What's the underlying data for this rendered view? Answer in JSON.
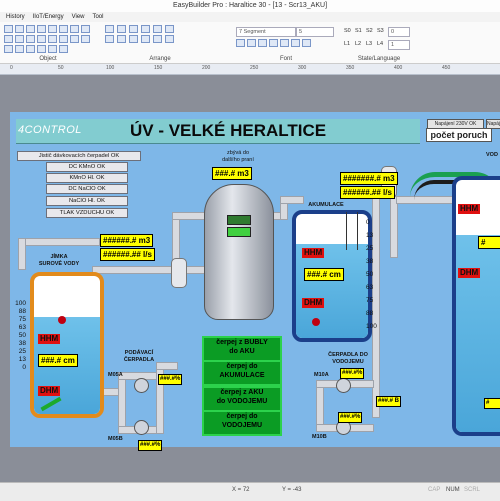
{
  "window": {
    "title": "EasyBuilder Pro : Haraltice 30 - [13 - Scr13_AKU]"
  },
  "menu": [
    "History",
    "IIoT/Energy",
    "View",
    "Tool"
  ],
  "ribbon": {
    "groups": {
      "object": "Object",
      "arrange": "Arrange",
      "font": "Font",
      "state": "State/Language"
    },
    "font_name": "7 Segment",
    "font_size": "5",
    "state_buttons": [
      "S0",
      "S1",
      "S2",
      "S3"
    ],
    "lang_buttons": [
      "L1",
      "L2",
      "L3",
      "L4"
    ],
    "state_value": "0",
    "lang_value": "1"
  },
  "ruler": [
    "0",
    "50",
    "100",
    "150",
    "200",
    "250",
    "300",
    "350",
    "400",
    "450"
  ],
  "hmi": {
    "logo": "4CONTROL",
    "title": "ÚV - VELKÉ HERALTICE",
    "flag1": "Napájení 230V OK",
    "flag2": "Napájení",
    "flag3": "Napájení 2",
    "poruch": "počet poruch",
    "status_labels": [
      "Jistič dávkovacích čerpadel OK",
      "DC KMnO OK",
      "KMnO Hl. OK",
      "DC NaClO OK",
      "NaClO Hl. OK",
      "TLAK VZDUCHU OK"
    ],
    "zbyva_label": "zbývá do\ndalšího praní",
    "zbyva_value": "###.# m3",
    "akumulace_label": "AKUMULACE",
    "akumulace_flow_m3": "#######.# m3",
    "akumulace_flow_ls": "######.## l/s",
    "vod_label": "VOD",
    "jimka_label": "JÍMKA\nSUROVÉ VODY",
    "jimka_flow_m3": "######.# m3",
    "jimka_flow_ls": "######.## l/s",
    "jimka_level": "###.# cm",
    "aku_level": "###.# cm",
    "hhm": "HHM",
    "dhm": "DHM",
    "scale": [
      "100",
      "88",
      "75",
      "63",
      "50",
      "38",
      "25",
      "13",
      "0"
    ],
    "scale_aku": [
      "0",
      "13",
      "25",
      "38",
      "50",
      "63",
      "75",
      "88",
      "100"
    ],
    "podavaci_label": "PODÁVACÍ\nČERPADLA",
    "cerpadla_vod_label": "ČERPADLA DO\nVODOJEMU",
    "m05a": "M05A",
    "m05b": "M05B",
    "m10a": "M10A",
    "m10b": "M10B",
    "pct_a": "###.#%",
    "pct_b": "###.#%",
    "pct_c": "###.#%",
    "pct_d": "###.#%",
    "bar_value": "###.# B",
    "g_buttons": [
      "čerpej z BUBLY\ndo AKU",
      "čerpej do\nAKUMULACE",
      "čerpej z AKU\ndo VODOJEMU",
      "čerpej do\nVODOJEMU"
    ],
    "right_values": [
      "#",
      "#"
    ]
  },
  "status": {
    "x": "X = 72",
    "y": "Y = -43",
    "caps": "CAP",
    "num": "NUM",
    "scrl": "SCRL"
  }
}
